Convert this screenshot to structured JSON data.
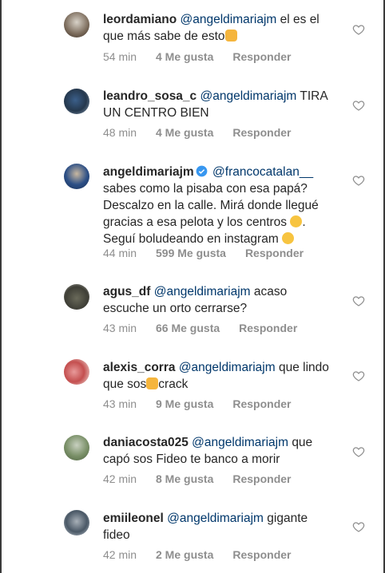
{
  "comments": [
    {
      "username": "leordamiano",
      "mention": "@angeldimariajm",
      "text_lines": [
        "el es el",
        "que más sabe de esto"
      ],
      "emoji": "flexed-biceps",
      "time": "54 min",
      "likes": "4 Me gusta",
      "reply": "Responder"
    },
    {
      "username": "leandro_sosa_c",
      "mention": "@angeldimariajm",
      "text_lines": [
        "TIRA",
        "UN CENTRO BIEN"
      ],
      "time": "48 min",
      "likes": "4 Me gusta",
      "reply": "Responder"
    },
    {
      "username": "angeldimariajm",
      "verified": true,
      "mention": "@francocatalan__",
      "text_lines": [
        "sabes como la pisaba con esa papá?",
        "Descalzo en la calle. Mirá donde llegué",
        "gracias a esa pelota y los centros",
        "Seguí boludeando en instagram"
      ],
      "emoji": "winking-face",
      "time": "44 min",
      "likes": "599 Me gusta",
      "reply": "Responder"
    },
    {
      "username": "agus_df",
      "mention": "@angeldimariajm",
      "text_lines": [
        "acaso",
        "escuche un orto cerrarse?"
      ],
      "time": "43 min",
      "likes": "66 Me gusta",
      "reply": "Responder"
    },
    {
      "username": "alexis_corra",
      "mention": "@angeldimariajm",
      "text_lines": [
        "que lindo",
        "que sos",
        "crack"
      ],
      "emoji": "clapping-hands",
      "time": "43 min",
      "likes": "9 Me gusta",
      "reply": "Responder"
    },
    {
      "username": "daniacosta025",
      "mention": "@angeldimariajm",
      "text_lines": [
        "que",
        "capó sos Fideo te banco a morir"
      ],
      "time": "42 min",
      "likes": "8 Me gusta",
      "reply": "Responder"
    },
    {
      "username": "emiileonel",
      "mention": "@angeldimariajm",
      "text_lines": [
        "gigante",
        "fideo"
      ],
      "time": "42 min",
      "likes": "2 Me gusta",
      "reply": "Responder"
    }
  ],
  "colors": {
    "text": "#262626",
    "mention": "#00376b",
    "meta": "#8e8e8e",
    "verified": "#3897f0"
  },
  "icons": {
    "like": "heart-outline-icon",
    "verified": "verified-badge-icon"
  }
}
